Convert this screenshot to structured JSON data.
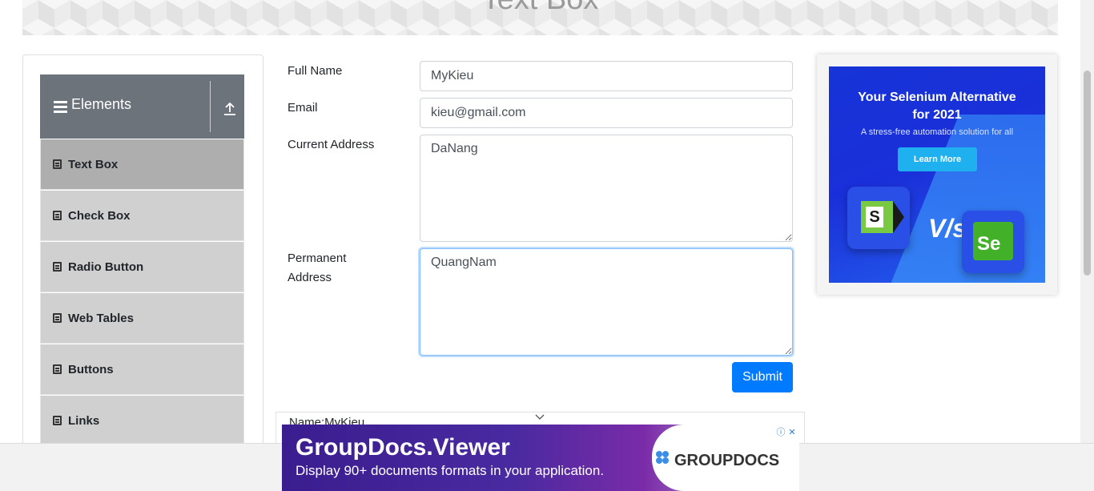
{
  "header": {
    "title": "Text Box"
  },
  "sidebar": {
    "group_title": "Elements",
    "items": [
      {
        "label": "Text Box",
        "active": true
      },
      {
        "label": "Check Box"
      },
      {
        "label": "Radio Button"
      },
      {
        "label": "Web Tables"
      },
      {
        "label": "Buttons"
      },
      {
        "label": "Links"
      }
    ]
  },
  "form": {
    "full_name": {
      "label": "Full Name",
      "value": "MyKieu"
    },
    "email": {
      "label": "Email",
      "value": "kieu@gmail.com"
    },
    "current_address": {
      "label": "Current Address",
      "value": "DaNang"
    },
    "permanent_address": {
      "label_line1": "Permanent",
      "label_line2": "Address",
      "value": "QuangNam"
    },
    "submit_label": "Submit"
  },
  "output": {
    "name_line": "Name:MyKieu"
  },
  "side_ad": {
    "headline_line1": "Your Selenium Alternative",
    "headline_line2": "for 2021",
    "subline": "A stress-free automation solution for all",
    "cta": "Learn More",
    "logo_left": "S",
    "vs": "V/s",
    "logo_right": "Se"
  },
  "bottom_ad": {
    "title": "GroupDocs.Viewer",
    "subtitle": "Display 90+ documents formats in your application.",
    "brand": "GROUPDOCS",
    "choices_info": "ⓘ",
    "choices_close": "✕"
  },
  "colors": {
    "accent": "#007bff",
    "sidebar_header": "#6c737b",
    "menu_bg": "#d0d0d0",
    "menu_active": "#aeaeae"
  }
}
